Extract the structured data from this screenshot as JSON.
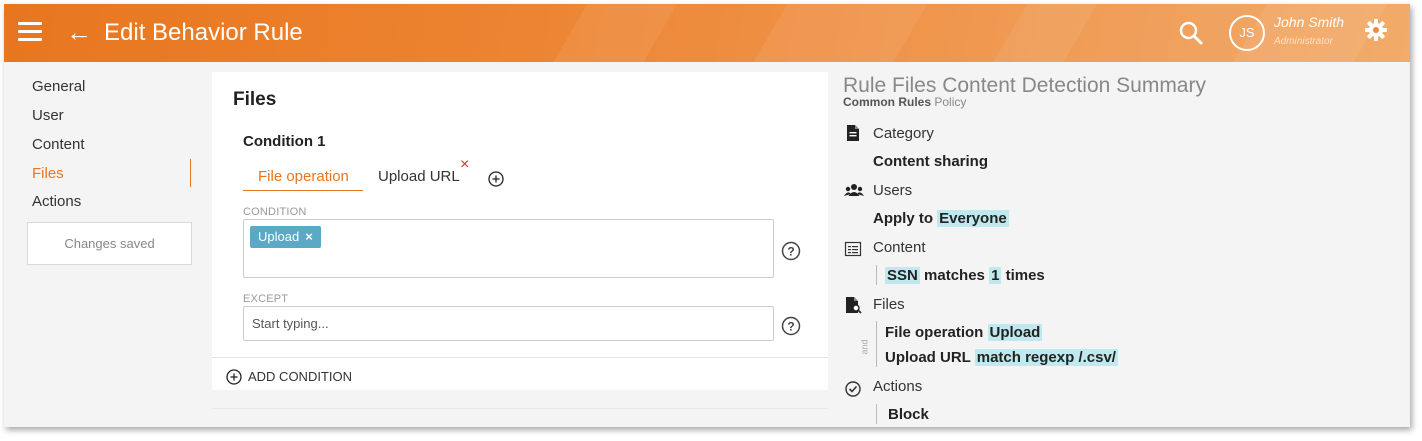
{
  "header": {
    "title": "Edit Behavior Rule",
    "user_initials": "JS",
    "user_name": "John Smith",
    "user_role": "Administrator",
    "colors": {
      "accent": "#e8761f",
      "header_start": "#e8761f",
      "header_end": "#f2ab6a"
    }
  },
  "sidebar": {
    "items": [
      {
        "label": "General",
        "active": false
      },
      {
        "label": "User",
        "active": false
      },
      {
        "label": "Content",
        "active": false
      },
      {
        "label": "Files",
        "active": true
      },
      {
        "label": "Actions",
        "active": false
      }
    ],
    "status": "Changes saved"
  },
  "main": {
    "title": "Files",
    "condition_title": "Condition 1",
    "tabs": [
      {
        "label": "File operation",
        "active": true
      },
      {
        "label": "Upload URL",
        "active": false
      }
    ],
    "tab_close": "×",
    "condition_label": "CONDITION",
    "condition_chip": "Upload",
    "chip_remove": "×",
    "except_label": "EXCEPT",
    "except_placeholder": "Start typing...",
    "add_condition": "ADD CONDITION"
  },
  "summary": {
    "title": "Rule Files Content Detection Summary",
    "policy_name": "Common Rules",
    "policy_suffix": "Policy",
    "category": {
      "label": "Category",
      "value": "Content sharing"
    },
    "users": {
      "label": "Users",
      "prefix": "Apply to",
      "value": "Everyone"
    },
    "content": {
      "label": "Content",
      "type": "SSN",
      "verb": "matches",
      "count": "1",
      "suffix": "times"
    },
    "files": {
      "label": "Files",
      "joiner": "and",
      "lines": [
        {
          "name": "File operation",
          "value": "Upload"
        },
        {
          "name": "Upload URL",
          "value": "match regexp /.csv/"
        }
      ]
    },
    "actions": {
      "label": "Actions",
      "value": "Block"
    },
    "highlight_color": "#bfe8ef"
  }
}
